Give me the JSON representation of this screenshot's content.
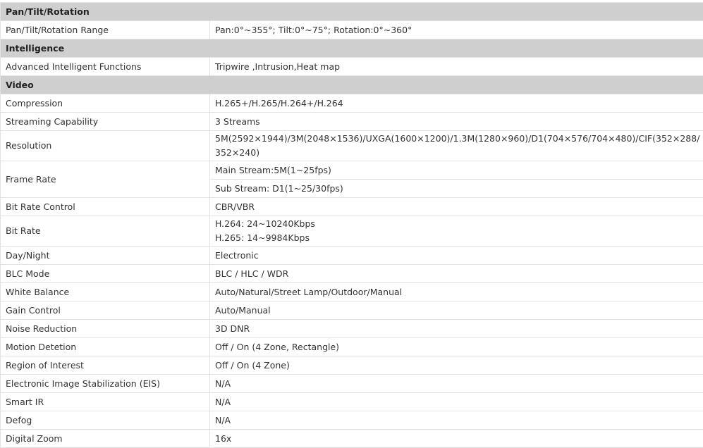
{
  "sections": {
    "pan_tilt": {
      "title": "Pan/Tilt/Rotation",
      "rows": [
        {
          "label": "Pan/Tilt/Rotation Range",
          "value": "Pan:0°~355°; Tilt:0°~75°; Rotation:0°~360°"
        }
      ]
    },
    "intelligence": {
      "title": "Intelligence",
      "rows": [
        {
          "label": "Advanced Intelligent Functions",
          "value": "Tripwire ,Intrusion,Heat map"
        }
      ]
    },
    "video": {
      "title": "Video",
      "rows": [
        {
          "label": "Compression",
          "value": "H.265+/H.265/H.264+/H.264"
        },
        {
          "label": "Streaming Capability",
          "value": "3 Streams"
        },
        {
          "label": "Resolution",
          "value_line1": "5M(2592×1944)/3M(2048×1536)/UXGA(1600×1200)/1.3M(1280×960)/D1(704×576/704×480)/CIF(352×288/",
          "value_line2": "352×240)"
        },
        {
          "label": "Frame Rate",
          "value_main": "Main Stream:5M(1~25fps)",
          "value_sub": "Sub Stream: D1(1~25/30fps)"
        },
        {
          "label": "Bit Rate Control",
          "value": "CBR/VBR"
        },
        {
          "label": "Bit Rate",
          "value_line1": "H.264: 24~10240Kbps",
          "value_line2": "H.265: 14~9984Kbps"
        },
        {
          "label": "Day/Night",
          "value": "Electronic"
        },
        {
          "label": "BLC Mode",
          "value": "BLC / HLC / WDR"
        },
        {
          "label": "White Balance",
          "value": "Auto/Natural/Street Lamp/Outdoor/Manual"
        },
        {
          "label": "Gain Control",
          "value": "Auto/Manual"
        },
        {
          "label": "Noise Reduction",
          "value": "3D DNR"
        },
        {
          "label": "Motion Detetion",
          "value": "Off / On (4 Zone, Rectangle)"
        },
        {
          "label": "Region of Interest",
          "value": "Off / On (4 Zone)"
        },
        {
          "label": "Electronic Image Stabilization (EIS)",
          "value": "N/A"
        },
        {
          "label": "Smart IR",
          "value": "N/A"
        },
        {
          "label": "Defog",
          "value": "N/A"
        },
        {
          "label": "Digital Zoom",
          "value": "16x"
        }
      ]
    }
  }
}
